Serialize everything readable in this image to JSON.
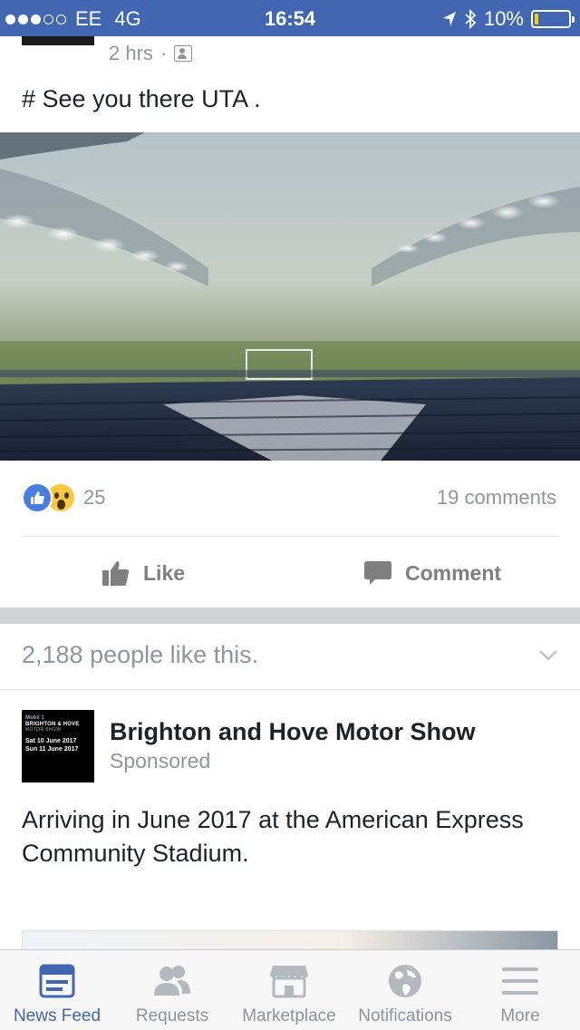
{
  "status_bar": {
    "carrier": "EE",
    "network": "4G",
    "time": "16:54",
    "battery": "10%"
  },
  "post": {
    "time": "2 hrs",
    "separator": "·",
    "text": "# See you there UTA .",
    "reactions_count": "25",
    "comments_count": "19 comments",
    "like_label": "Like",
    "comment_label": "Comment"
  },
  "page_likes": {
    "text": "2,188 people like this."
  },
  "ad": {
    "logo": {
      "brand": "Mobil 1",
      "title": "BRIGHTON & HOVE",
      "subtitle": "MOTOR SHOW",
      "date1": "Sat 10 June 2017",
      "date2": "Sun 11 June 2017"
    },
    "name": "Brighton and Hove Motor Show",
    "sponsored": "Sponsored",
    "text": "Arriving in June 2017 at the American Express Community Stadium."
  },
  "tabs": [
    {
      "label": "News Feed",
      "icon": "news-feed-icon",
      "active": true
    },
    {
      "label": "Requests",
      "icon": "requests-icon"
    },
    {
      "label": "Marketplace",
      "icon": "marketplace-icon"
    },
    {
      "label": "Notifications",
      "icon": "globe-icon"
    },
    {
      "label": "More",
      "icon": "menu-icon"
    }
  ],
  "colors": {
    "brand": "#4267b2",
    "muted": "#90949c",
    "battery_low": "#f7d000"
  }
}
